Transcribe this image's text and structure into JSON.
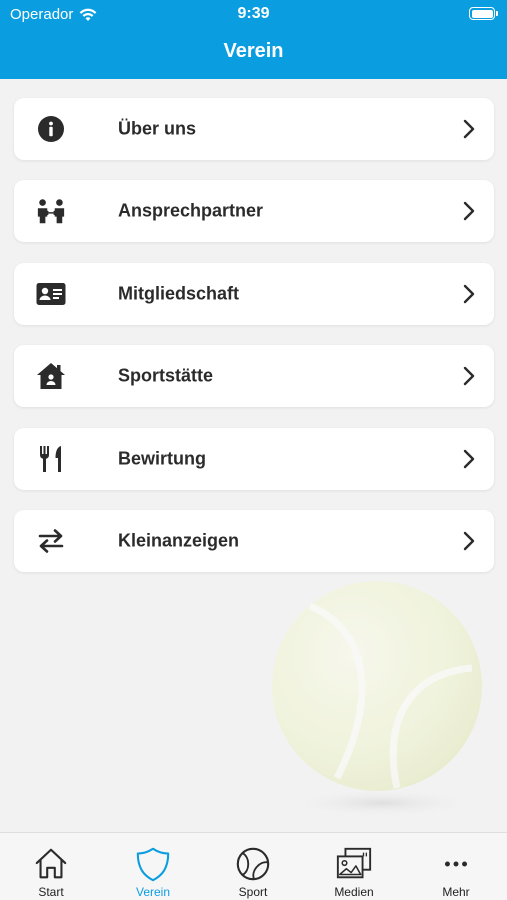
{
  "status_bar": {
    "carrier": "Operador",
    "time": "9:39"
  },
  "nav": {
    "title": "Verein"
  },
  "menu": {
    "items": [
      {
        "label": "Über uns",
        "icon": "info-icon"
      },
      {
        "label": "Ansprechpartner",
        "icon": "contacts-icon"
      },
      {
        "label": "Mitgliedschaft",
        "icon": "id-card-icon"
      },
      {
        "label": "Sportstätte",
        "icon": "home-icon"
      },
      {
        "label": "Bewirtung",
        "icon": "fork-knife-icon"
      },
      {
        "label": "Kleinanzeigen",
        "icon": "exchange-icon"
      }
    ]
  },
  "tabbar": {
    "active_color": "#0a9ee0",
    "items": [
      {
        "label": "Start",
        "icon": "house-icon"
      },
      {
        "label": "Verein",
        "icon": "shield-icon",
        "active": true
      },
      {
        "label": "Sport",
        "icon": "tennis-ball-icon"
      },
      {
        "label": "Medien",
        "icon": "gallery-icon"
      },
      {
        "label": "Mehr",
        "icon": "more-dots-icon"
      }
    ]
  },
  "colors": {
    "header": "#0a9ee0",
    "background": "#f2f2f2"
  }
}
